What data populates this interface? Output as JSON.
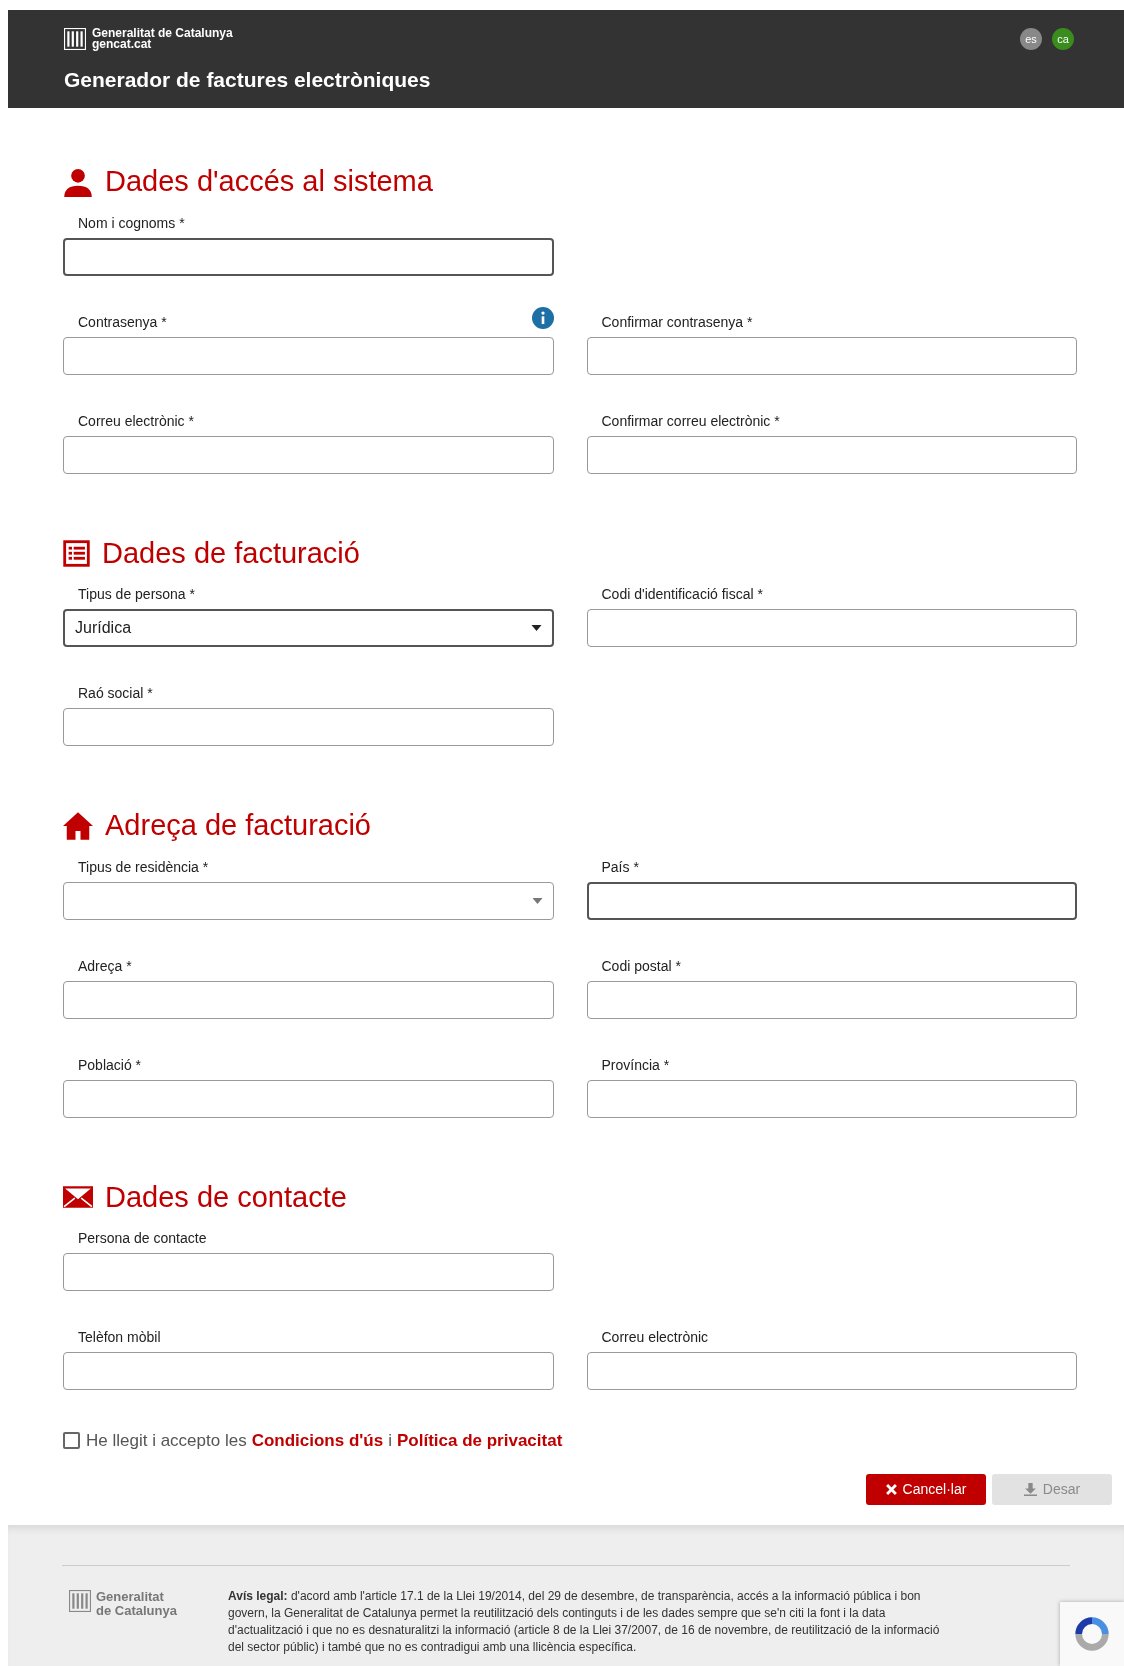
{
  "header": {
    "logo_lines": [
      "Generalitat de Catalunya",
      "gencat.cat"
    ],
    "title": "Generador de factures electròniques",
    "languages": [
      {
        "label": "es",
        "selected": false
      },
      {
        "label": "ca",
        "selected": true
      }
    ]
  },
  "sections": [
    {
      "kind": "person",
      "title": "Dades d'accés al sistema",
      "rows": [
        [
          {
            "label": "Nom i cognoms *",
            "kind": "text",
            "focused": true
          }
        ],
        [
          {
            "label": "Contrasenya *",
            "kind": "text",
            "focused": false,
            "info": true
          },
          {
            "label": "Confirmar contrasenya *",
            "kind": "text",
            "focused": false
          }
        ],
        [
          {
            "label": "Correu electrònic *",
            "kind": "text",
            "focused": false
          },
          {
            "label": "Confirmar correu electrònic *",
            "kind": "text",
            "focused": false
          }
        ]
      ]
    },
    {
      "kind": "list",
      "title": "Dades de facturació",
      "rows": [
        [
          {
            "label": "Tipus de persona *",
            "kind": "select",
            "value": "Jurídica",
            "focused": true
          },
          {
            "label": "Codi d'identificació fiscal *",
            "kind": "text",
            "focused": false
          }
        ],
        [
          {
            "label": "Raó social *",
            "kind": "text",
            "focused": false
          }
        ]
      ]
    },
    {
      "kind": "home",
      "title": "Adreça de facturació",
      "rows": [
        [
          {
            "label": "Tipus de residència *",
            "kind": "select",
            "focused": false
          },
          {
            "label": "País *",
            "kind": "text",
            "focused": true
          }
        ],
        [
          {
            "label": "Adreça *",
            "kind": "text",
            "focused": false
          },
          {
            "label": "Codi postal *",
            "kind": "text",
            "focused": false
          }
        ],
        [
          {
            "label": "Població *",
            "kind": "text",
            "focused": false
          },
          {
            "label": "Província *",
            "kind": "text",
            "focused": false
          }
        ]
      ]
    },
    {
      "kind": "mail",
      "title": "Dades de contacte",
      "rows": [
        [
          {
            "label": "Persona de contacte",
            "kind": "text",
            "focused": false
          }
        ],
        [
          {
            "label": "Telèfon mòbil",
            "kind": "text",
            "focused": false
          },
          {
            "label": "Correu electrònic",
            "kind": "text",
            "focused": false
          }
        ]
      ]
    }
  ],
  "consent": {
    "checked": false,
    "text": "He llegit i accepto les",
    "link_1": "Condicions d'ús",
    "joiner": "i",
    "link_2": "Política de privacitat"
  },
  "buttons": [
    {
      "kind": "cancel",
      "label": "Cancel·lar",
      "disabled": false
    },
    {
      "kind": "save",
      "label": "Desar",
      "disabled": true
    }
  ],
  "footer": {
    "logo_lines": [
      "Generalitat",
      "de Catalunya"
    ],
    "legal": "**Avís legal:** d'acord amb l'article 17.1 de la Llei 19/2014, del 29 de desembre, de transparència, accés a la informació pública i bon govern, la Generalitat de Catalunya permet la reutilització dels continguts i de les dades sempre que se'n citi la font i la data d'actualització i que no es desnaturalitzi la informació (article 8 de la Llei 37/2007, de 16 de novembre, de reutilització de la informació del sector públic) i també que no es contradigui amb una llicència específica."
  }
}
